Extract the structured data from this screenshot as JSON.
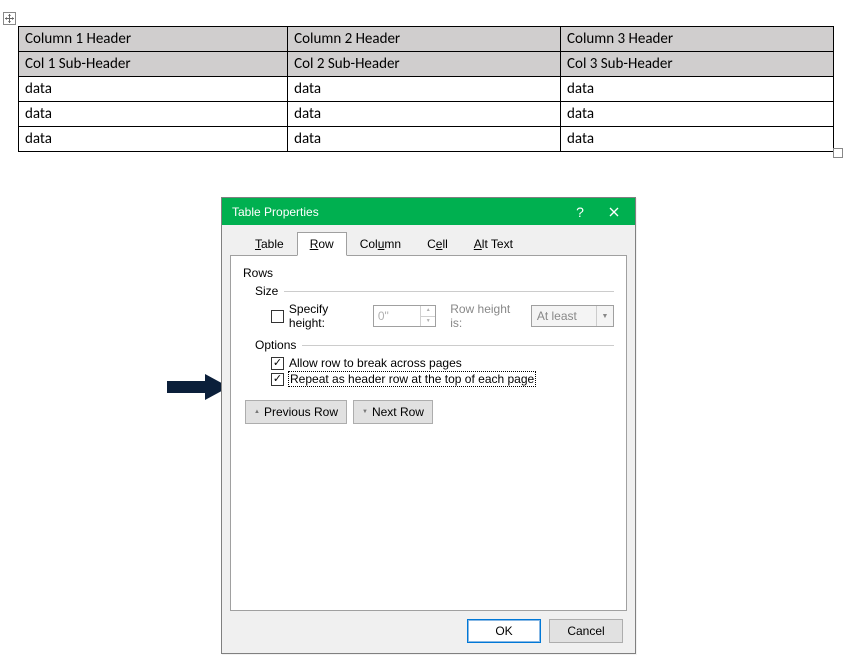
{
  "table": {
    "headers": [
      "Column 1 Header",
      "Column 2 Header",
      "Column 3 Header"
    ],
    "subheaders": [
      "Col 1 Sub-Header",
      "Col 2 Sub-Header",
      "Col 3 Sub-Header"
    ],
    "rows": [
      [
        "data",
        "data",
        "data"
      ],
      [
        "data",
        "data",
        "data"
      ],
      [
        "data",
        "data",
        "data"
      ]
    ]
  },
  "dialog": {
    "title": "Table Properties",
    "tabs": {
      "table": "Table",
      "row": "Row",
      "column": "Column",
      "cell": "Cell",
      "alttext": "Alt Text"
    },
    "rows_label": "Rows",
    "size_label": "Size",
    "specify_height": "Specify height:",
    "height_value": "0\"",
    "row_height_is": "Row height is:",
    "row_height_mode": "At least",
    "options_label": "Options",
    "allow_break": "Allow row to break across pages",
    "repeat_header": "Repeat as header row at the top of each page",
    "prev_row": "Previous Row",
    "next_row": "Next Row",
    "ok": "OK",
    "cancel": "Cancel"
  }
}
